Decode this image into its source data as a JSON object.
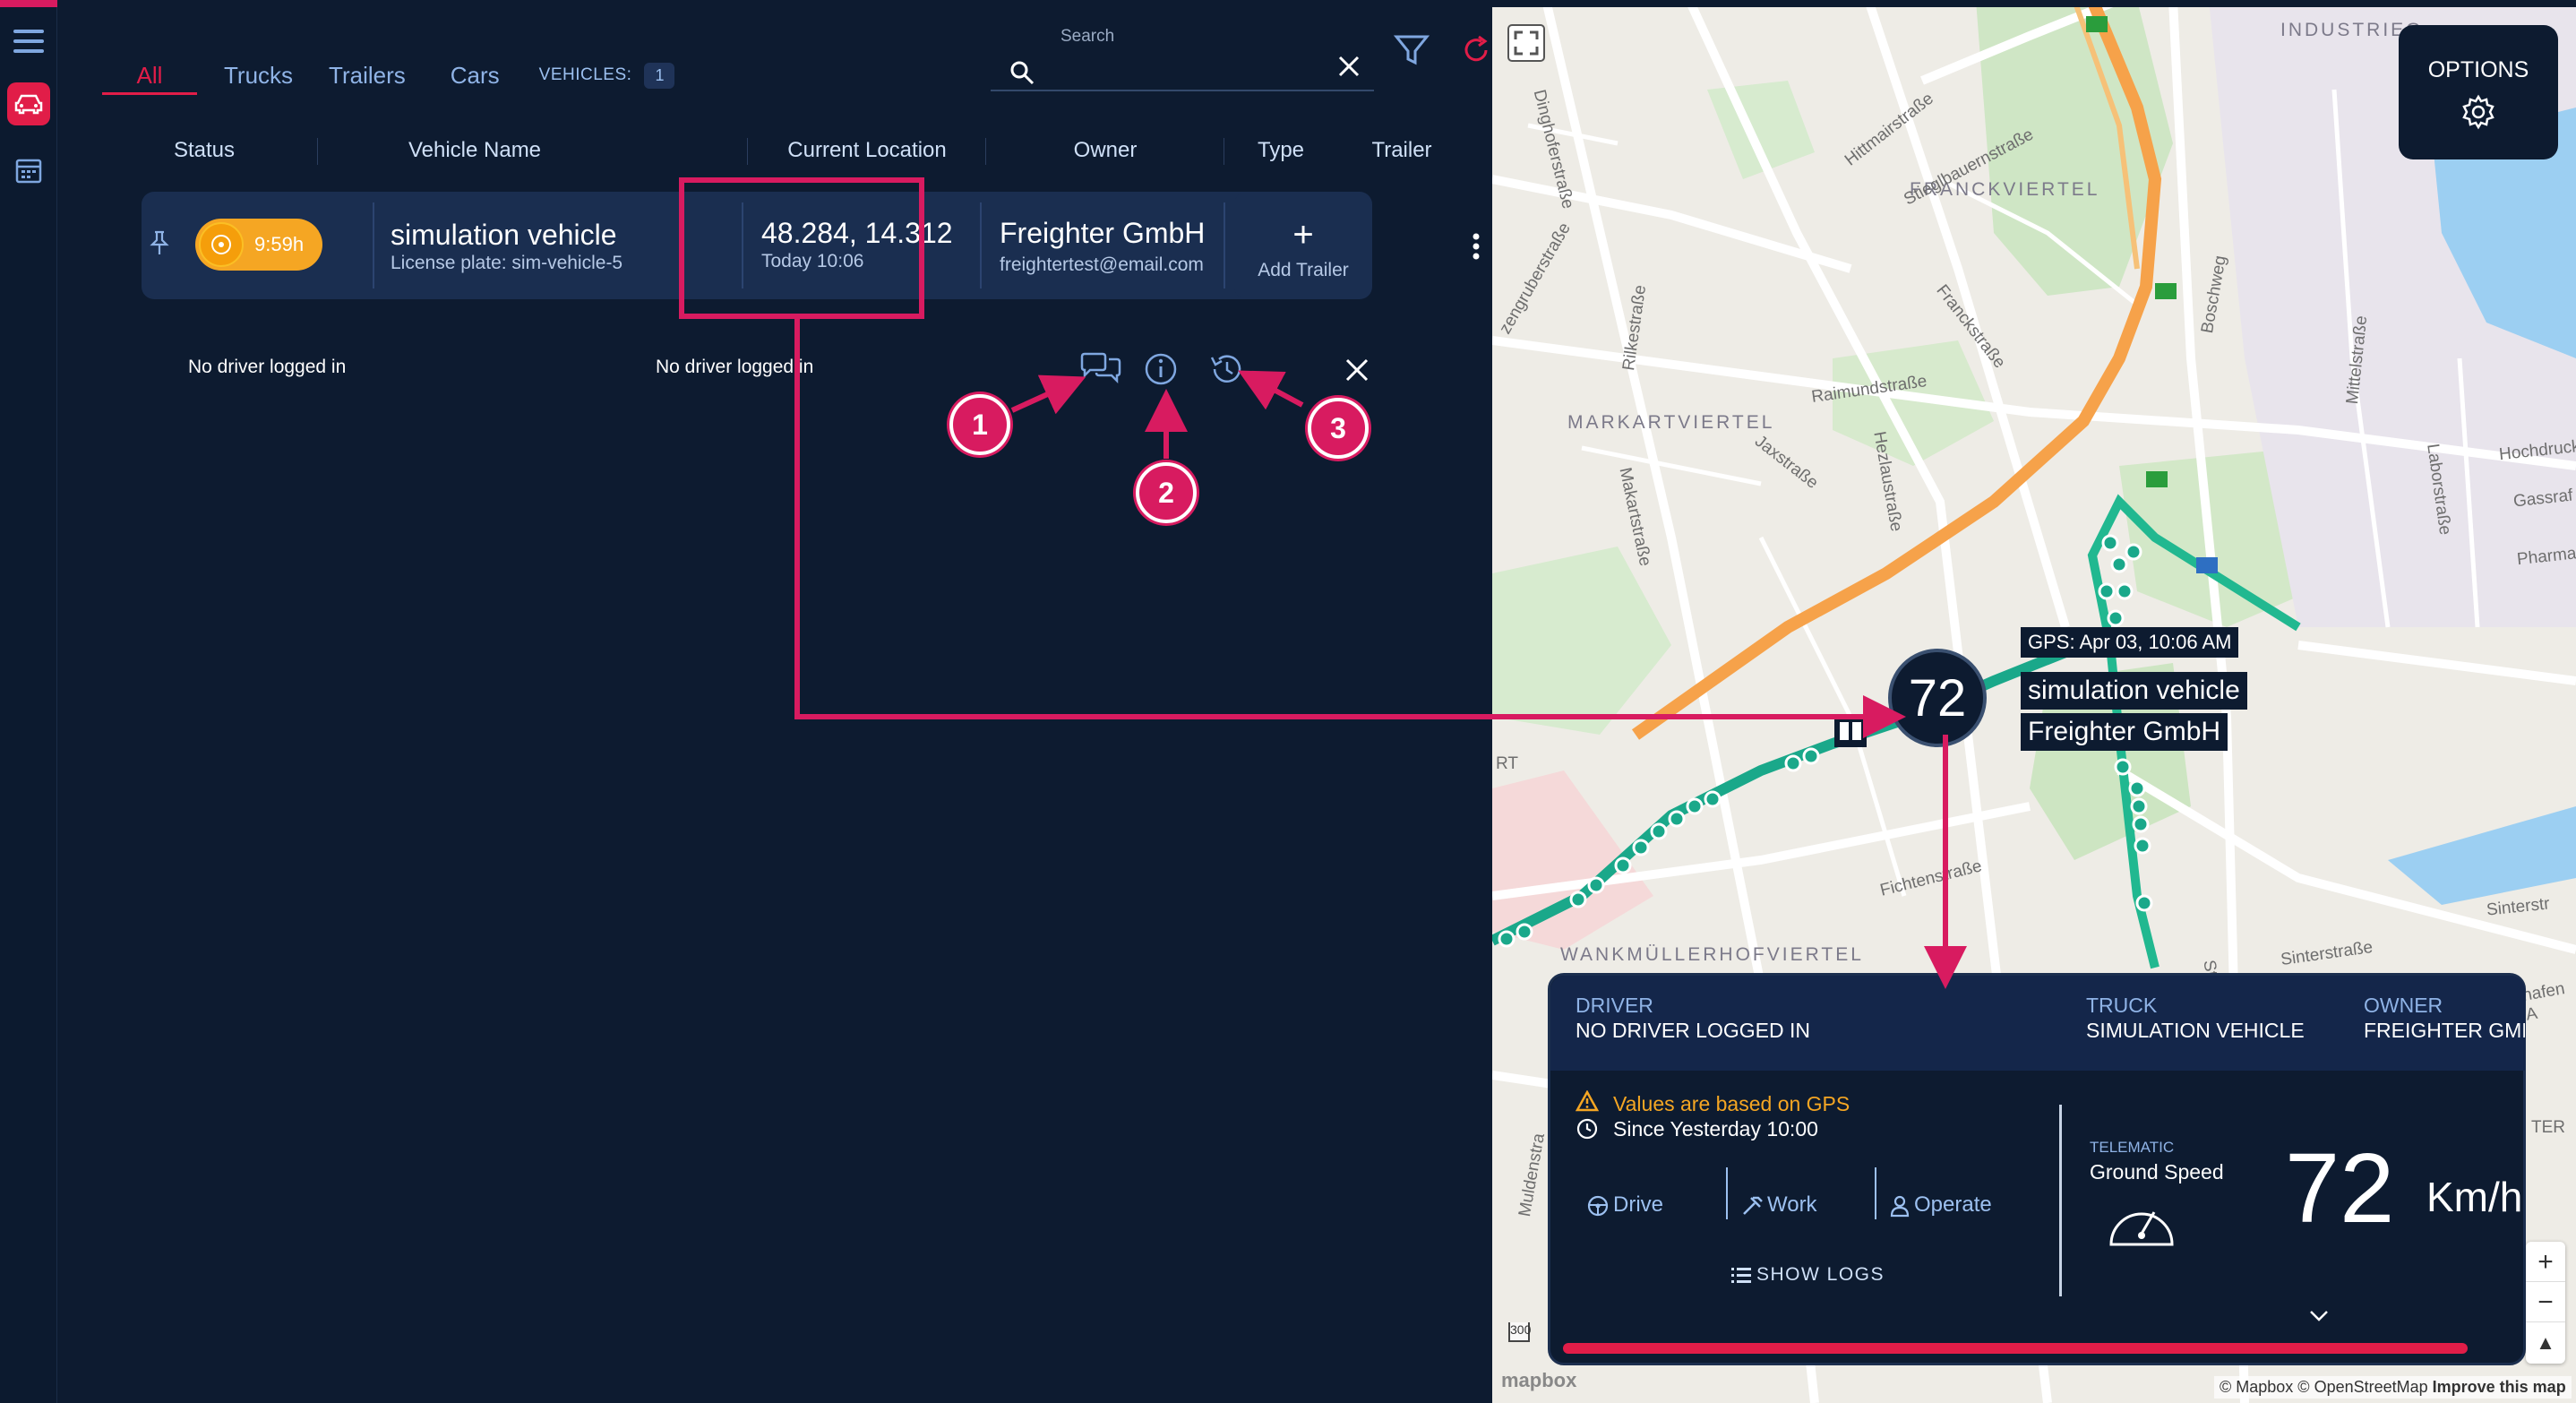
{
  "tabs": [
    {
      "label": "All",
      "active": true
    },
    {
      "label": "Trucks"
    },
    {
      "label": "Trailers"
    },
    {
      "label": "Cars"
    }
  ],
  "vehicles_label": "VEHICLES:",
  "vehicles_count": "1",
  "search": {
    "label": "Search"
  },
  "columns": [
    "Status",
    "Vehicle Name",
    "Current Location",
    "Owner",
    "Type",
    "Trailer"
  ],
  "row": {
    "status_time": "9:59h",
    "vehicle_name": "simulation vehicle",
    "license_plate": "License plate: sim-vehicle-5",
    "location": "48.284, 14.312",
    "location_time": "Today 10:06",
    "owner": "Freighter GmbH",
    "owner_email": "freightertest@email.com",
    "add_trailer": "Add Trailer"
  },
  "driver_left": "No driver logged in",
  "driver_right": "No driver logged in",
  "badges": [
    "1",
    "2",
    "3"
  ],
  "map": {
    "options": "OPTIONS",
    "marker_speed": "72",
    "gps_tag": "GPS: Apr 03, 10:06 AM",
    "vehicle_tag": "simulation vehicle",
    "owner_tag": "Freighter GmbH",
    "attribution": "© Mapbox © OpenStreetMap",
    "improve": "Improve this map",
    "mapbox": "mapbox",
    "scale": "300",
    "labels": {
      "franckviertel": "FRANCKVIERTEL",
      "markartviertel": "MARKARTVIERTEL",
      "wankmueller": "WANKMÜLLERHOFVIERTEL",
      "industrie": "INDUSTRIEG",
      "raimund": "Raimundstraße",
      "fichten": "Fichtenstraße",
      "sinter": "Sinterstraße",
      "stahl": "Stahlstraße",
      "hoch": "Hochdrucks",
      "gass": "Gassraf",
      "pharma": "Pharmast",
      "laborstr": "Laborstraße",
      "hitmair": "Hittmairstraße",
      "stieglbauern": "Stieglbauernstraße",
      "franck": "Franckstraße",
      "rilke": "Rilkestraße",
      "jax": "Jaxstraße",
      "hez": "Hezlaustraße",
      "makart": "Makartstraße",
      "boschweg": "Boschweg",
      "dinghofer": "Dinghoferstraße",
      "muldenstr": "Muldenstra",
      "zengruber": "zengruberstraße",
      "mittel": "Mittelstraße",
      "rt": "RT",
      "ter": "TER",
      "sinterstr2": "Sinterstr",
      "hafen": "hafen A"
    }
  },
  "card": {
    "driver_label": "DRIVER",
    "driver_value": "NO DRIVER LOGGED IN",
    "truck_label": "TRUCK",
    "truck_value": "SIMULATION VEHICLE",
    "owner_label": "OWNER",
    "owner_value": "FREIGHTER GMB",
    "warning": "Values are based on GPS",
    "since": "Since Yesterday 10:00",
    "drive": "Drive",
    "work": "Work",
    "operate": "Operate",
    "show_logs": "SHOW LOGS",
    "telematic": "TELEMATIC",
    "ground_speed": "Ground Speed",
    "speed": "72",
    "unit": "Km/h"
  },
  "colors": {
    "accent": "#e11d48",
    "panel": "#0d1b30",
    "row": "#1a2e50",
    "status": "#f5a623",
    "route": "#1aa88a"
  }
}
